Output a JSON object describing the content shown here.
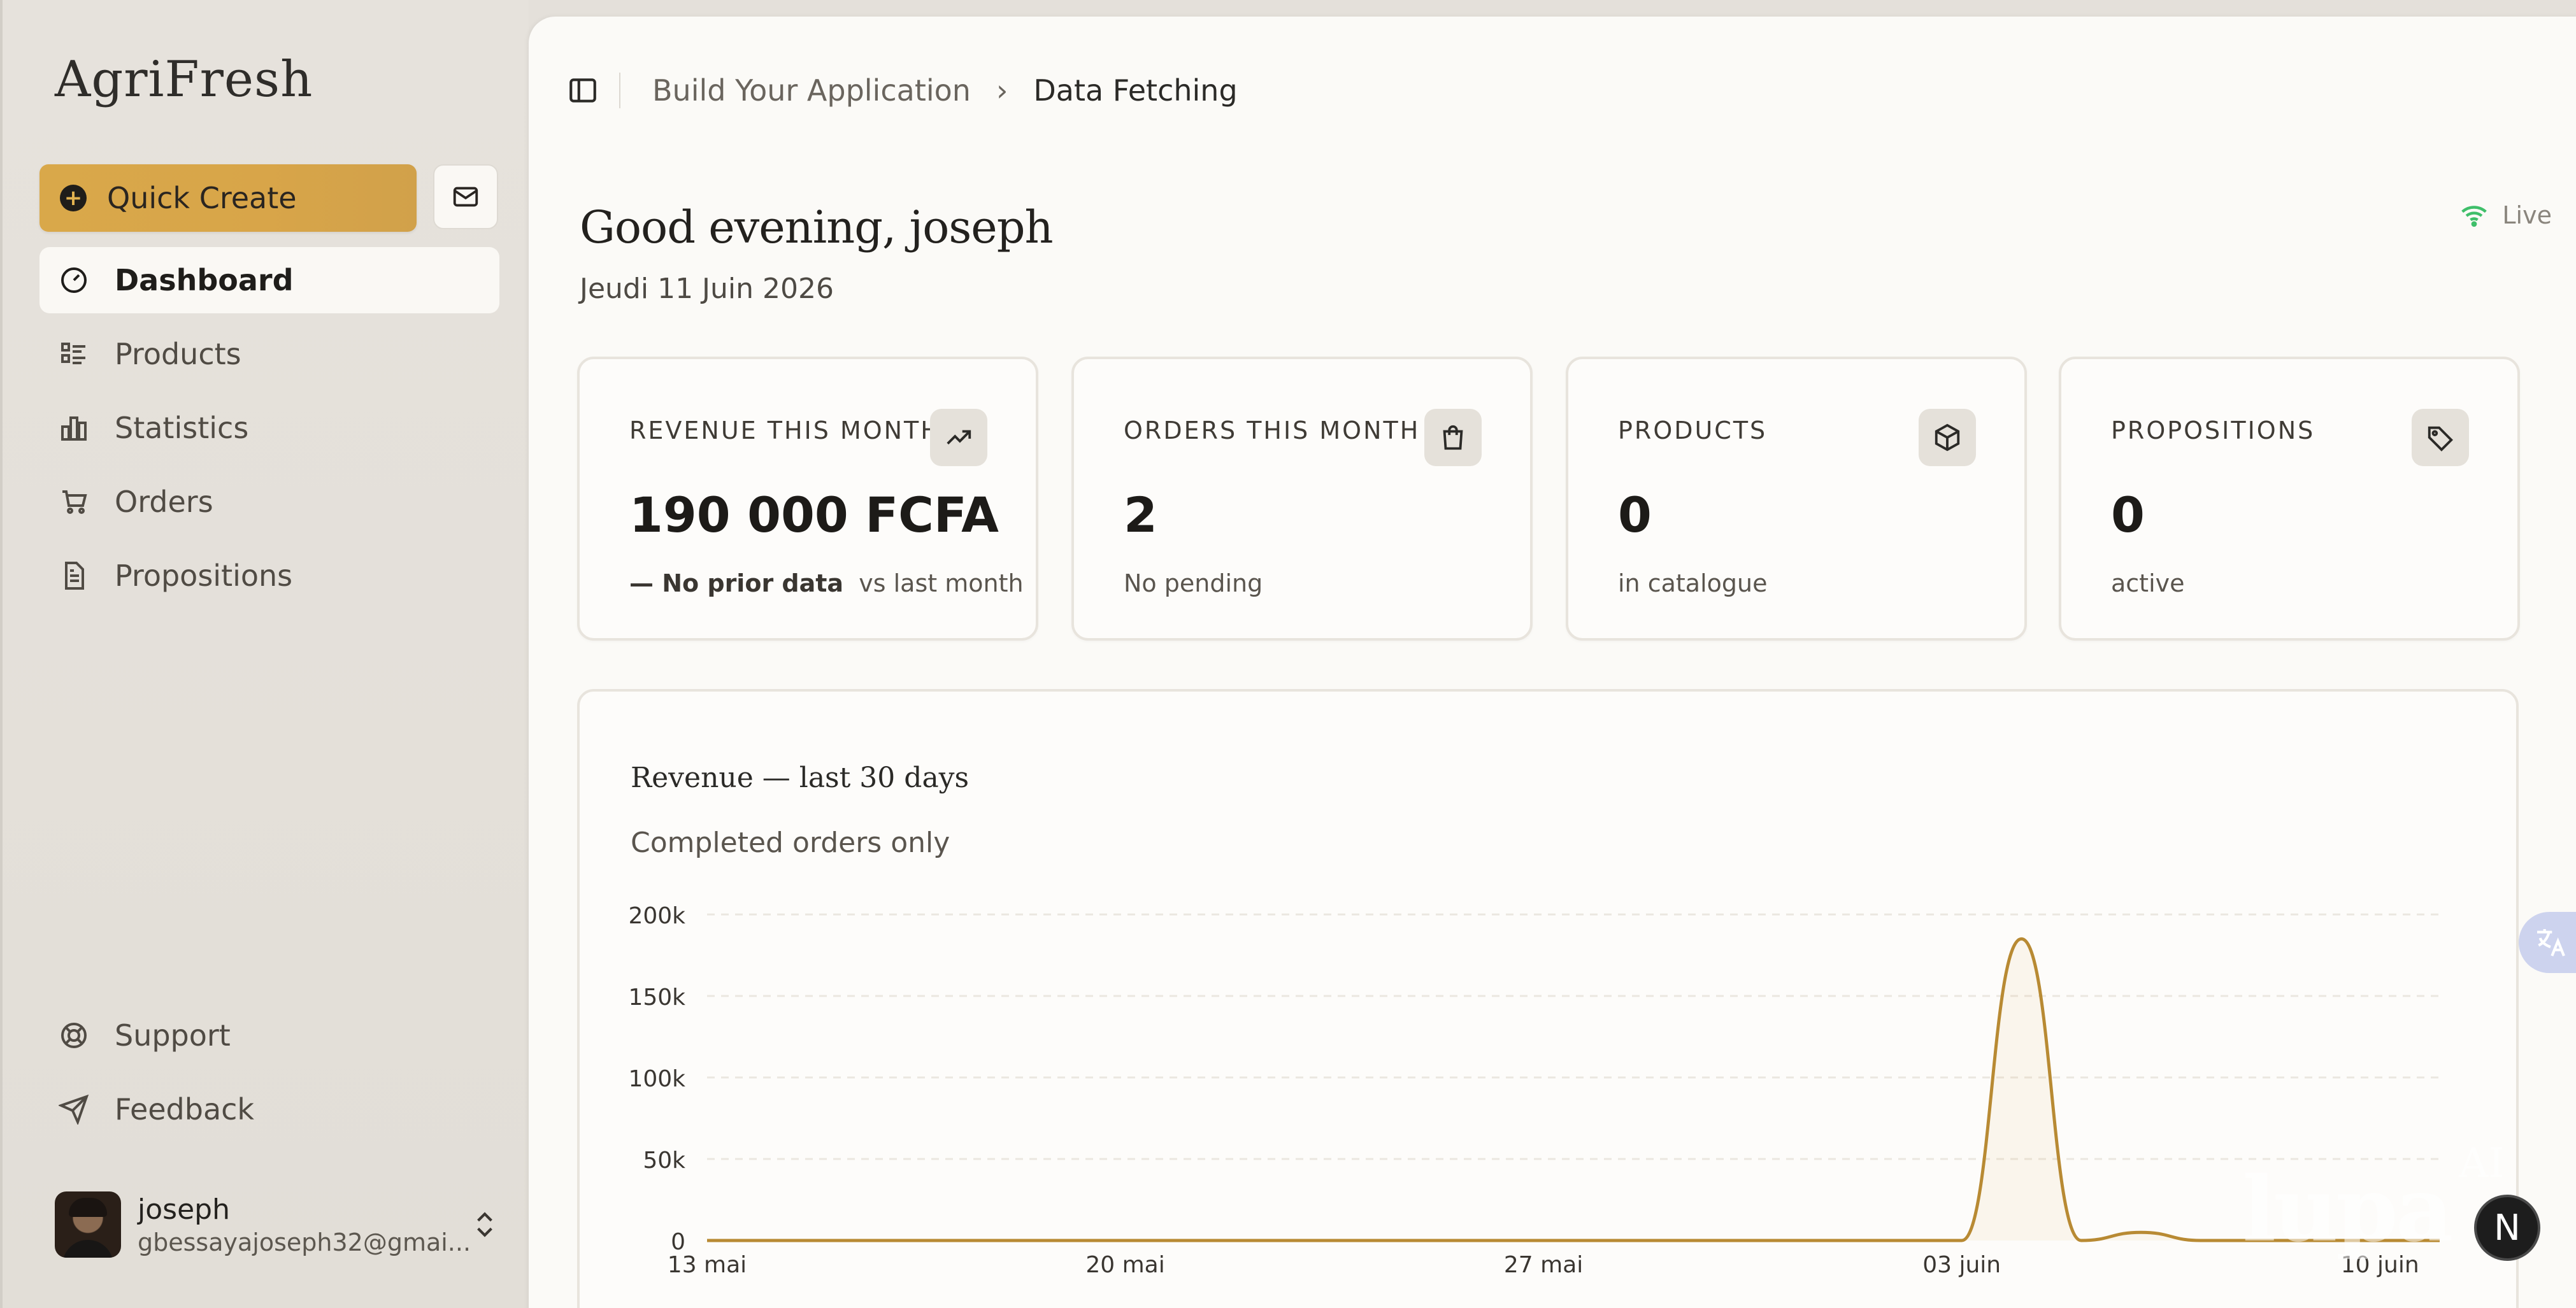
{
  "app": {
    "brand": "AgriFresh"
  },
  "sidebar": {
    "quick_create": "Quick Create",
    "items": [
      {
        "label": "Dashboard",
        "icon": "gauge-icon",
        "active": true
      },
      {
        "label": "Products",
        "icon": "list-icon"
      },
      {
        "label": "Statistics",
        "icon": "bar-chart-icon"
      },
      {
        "label": "Orders",
        "icon": "cart-icon"
      },
      {
        "label": "Propositions",
        "icon": "document-icon"
      }
    ],
    "bottom": [
      {
        "label": "Support",
        "icon": "lifebuoy-icon"
      },
      {
        "label": "Feedback",
        "icon": "send-icon"
      }
    ],
    "user": {
      "name": "joseph",
      "email": "gbessayajoseph32@gmai..."
    }
  },
  "header": {
    "breadcrumb": [
      "Build Your Application",
      "Data Fetching"
    ]
  },
  "main": {
    "greeting": "Good evening, joseph",
    "date": "Jeudi 11 Juin 2026",
    "status": "Live",
    "cards": [
      {
        "label": "REVENUE THIS MONTH",
        "value": "190 000 FCFA",
        "sub_strong": "— No prior data",
        "sub": "vs last month",
        "icon": "trending-up-icon"
      },
      {
        "label": "ORDERS THIS MONTH",
        "value": "2",
        "sub_strong": "",
        "sub": "No pending",
        "icon": "shopping-bag-icon"
      },
      {
        "label": "PRODUCTS",
        "value": "0",
        "sub_strong": "",
        "sub": "in catalogue",
        "icon": "package-icon"
      },
      {
        "label": "PROPOSITIONS",
        "value": "0",
        "sub_strong": "",
        "sub": "active",
        "icon": "tag-icon"
      }
    ],
    "chart": {
      "title": "Revenue — last 30 days",
      "subtitle": "Completed orders only"
    }
  },
  "overlays": {
    "watermark": "lupa",
    "watermark_ai": "AI",
    "next_badge": "N"
  },
  "colors": {
    "accent": "#d9a84a",
    "line": "#b88a33",
    "live": "#3fbf6a"
  },
  "chart_data": {
    "type": "area",
    "title": "Revenue — last 30 days",
    "subtitle": "Completed orders only",
    "xlabel": "",
    "ylabel": "",
    "x_ticks": [
      "13 mai",
      "20 mai",
      "27 mai",
      "03 juin",
      "10 juin"
    ],
    "y_ticks": [
      "0",
      "50k",
      "100k",
      "150k",
      "200k"
    ],
    "ylim": [
      0,
      200000
    ],
    "grid": true,
    "x": [
      "13 mai",
      "14 mai",
      "15 mai",
      "16 mai",
      "17 mai",
      "18 mai",
      "19 mai",
      "20 mai",
      "21 mai",
      "22 mai",
      "23 mai",
      "24 mai",
      "25 mai",
      "26 mai",
      "27 mai",
      "28 mai",
      "29 mai",
      "30 mai",
      "31 mai",
      "01 juin",
      "02 juin",
      "03 juin",
      "04 juin",
      "05 juin",
      "06 juin",
      "07 juin",
      "08 juin",
      "09 juin",
      "10 juin",
      "11 juin"
    ],
    "values": [
      0,
      0,
      0,
      0,
      0,
      0,
      0,
      0,
      0,
      0,
      0,
      0,
      0,
      0,
      0,
      0,
      0,
      0,
      0,
      0,
      0,
      0,
      185000,
      0,
      5000,
      0,
      0,
      0,
      0,
      0
    ]
  }
}
